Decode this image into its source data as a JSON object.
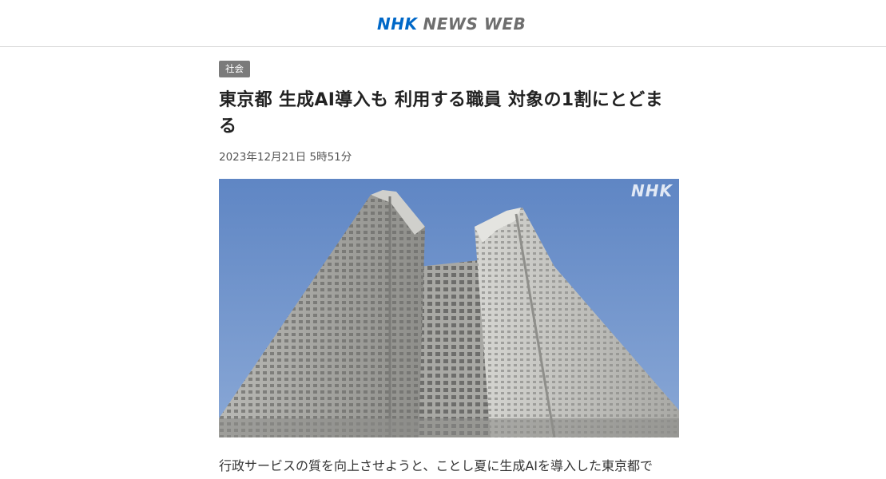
{
  "header": {
    "logo_nhk": "NHK",
    "logo_news": "NEWS WEB",
    "logo_nhk_color": "#0068c8",
    "logo_news_color": "#6e6e6e"
  },
  "article": {
    "category": "社会",
    "title": "東京都 生成AI導入も 利用する職員 対象の1割にとどまる",
    "date": "2023年12月21日 5時51分",
    "photo": {
      "watermark": "NHK",
      "subject": "tokyo-metropolitan-government-building"
    },
    "body": "行政サービスの質を向上させようと、ことし夏に生成AIを導入した東京都で"
  }
}
